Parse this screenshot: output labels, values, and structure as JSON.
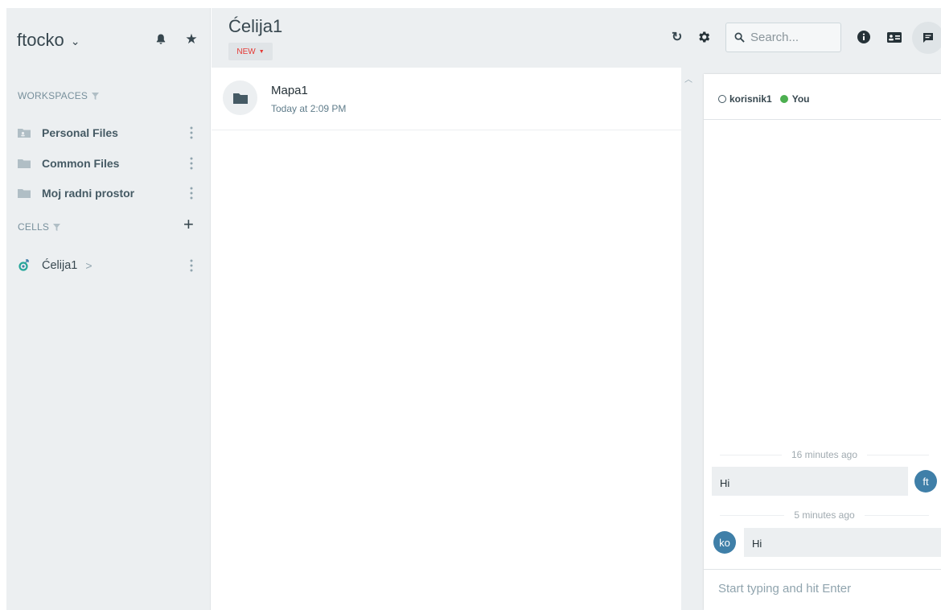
{
  "sidebar": {
    "user_name": "ftocko",
    "workspaces_title": "WORKSPACES",
    "workspaces": [
      {
        "label": "Personal Files",
        "icon": "folder-user-icon"
      },
      {
        "label": "Common Files",
        "icon": "folder-icon"
      },
      {
        "label": "Moj radni prostor",
        "icon": "folder-icon"
      }
    ],
    "cells_title": "CELLS",
    "cells": [
      {
        "label": "Ćelija1",
        "arrow": ">",
        "icon": "cell-icon"
      }
    ]
  },
  "header": {
    "title": "Ćelija1",
    "new_label": "NEW",
    "search_placeholder": "Search..."
  },
  "files": [
    {
      "name": "Mapa1",
      "date": "Today at 2:09 PM"
    }
  ],
  "chat": {
    "members": [
      "korisnik1",
      "You"
    ],
    "messages": [
      {
        "time": "16 minutes ago",
        "text": "Hi",
        "avatar": "ft"
      },
      {
        "time": "5 minutes ago",
        "text": "Hi",
        "avatar": "ko"
      }
    ],
    "composer_placeholder": "Start typing and hit Enter"
  },
  "colors": {
    "accent": "#3f7fa8",
    "sidebar_bg": "#eceff1",
    "new_text": "#e53935",
    "online": "#4caf50",
    "icon": "#37474f"
  }
}
